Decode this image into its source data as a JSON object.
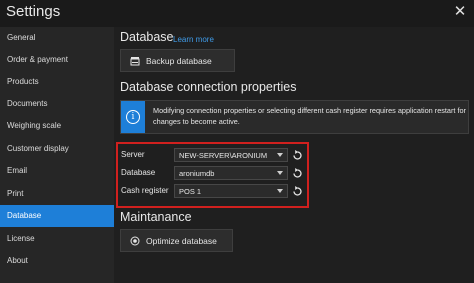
{
  "window": {
    "title": "Settings"
  },
  "sidebar": {
    "items": [
      {
        "label": "General"
      },
      {
        "label": "Order & payment"
      },
      {
        "label": "Products"
      },
      {
        "label": "Documents"
      },
      {
        "label": "Weighing scale"
      },
      {
        "label": "Customer display"
      },
      {
        "label": "Email"
      },
      {
        "label": "Print"
      },
      {
        "label": "Database",
        "active": true
      },
      {
        "label": "License"
      },
      {
        "label": "About"
      }
    ]
  },
  "database": {
    "heading": "Database",
    "learn_more": "Learn more",
    "backup_label": "Backup database"
  },
  "connection": {
    "heading": "Database connection properties",
    "info_text": "Modifying connection properties or selecting different cash register requires application restart for changes to become active.",
    "server_label": "Server",
    "server_value": "NEW-SERVER\\ARONIUM",
    "database_label": "Database",
    "database_value": "aroniumdb",
    "register_label": "Cash register",
    "register_value": "POS 1"
  },
  "maintenance": {
    "heading": "Maintanance",
    "optimize_label": "Optimize database"
  },
  "colors": {
    "accent": "#1e7fd8",
    "highlight_box": "#d0201e",
    "link": "#3f9be8"
  }
}
